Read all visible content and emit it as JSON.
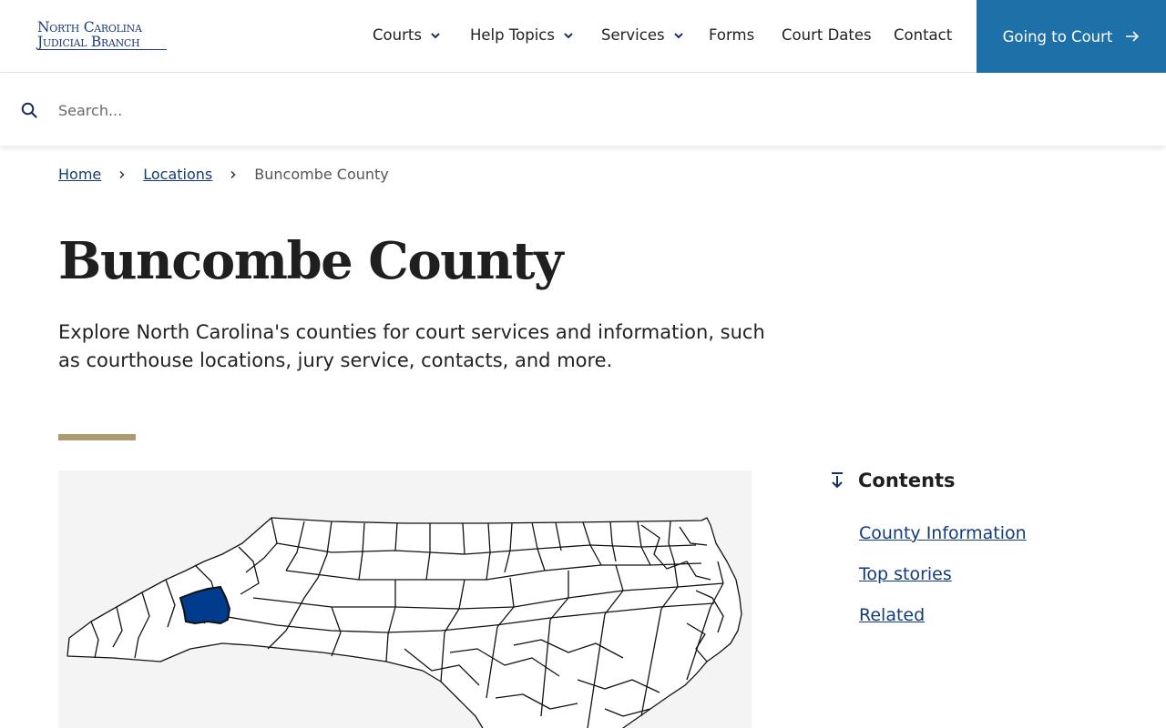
{
  "header": {
    "logo_line1": "North Carolina",
    "logo_line2": "Judicial Branch",
    "nav": [
      {
        "label": "Courts",
        "has_dropdown": true
      },
      {
        "label": "Help Topics",
        "has_dropdown": true
      },
      {
        "label": "Services",
        "has_dropdown": true
      },
      {
        "label": "Forms",
        "has_dropdown": false
      },
      {
        "label": "Court Dates",
        "has_dropdown": false
      },
      {
        "label": "Contact",
        "has_dropdown": false
      }
    ],
    "cta_label": "Going to Court"
  },
  "search": {
    "placeholder": "Search...",
    "value": ""
  },
  "breadcrumb": {
    "home": "Home",
    "locations": "Locations",
    "current": "Buncombe County"
  },
  "page": {
    "title": "Buncombe County",
    "intro": "Explore North Carolina's counties for court services and information, such as courthouse locations, jury service, contacts, and more."
  },
  "map": {
    "highlighted_county": "Buncombe County",
    "highlight_color": "#003b8e",
    "icon": "north-carolina-county-map"
  },
  "contents": {
    "title": "Contents",
    "items": [
      "County Information",
      "Top stories",
      "Related"
    ]
  },
  "colors": {
    "brand_blue": "#1a3a7a",
    "cta_blue": "#1e70a8",
    "accent_gold": "#ac9a72",
    "link_blue": "#123b7a"
  }
}
